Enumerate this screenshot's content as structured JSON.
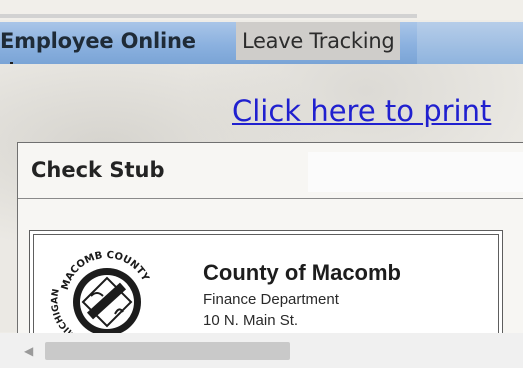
{
  "tabs": {
    "employee_online": "Employee Online",
    "leave_tracking": "Leave Tracking"
  },
  "print_link": "Click here to print",
  "check_stub": {
    "title": "Check Stub",
    "org_name": "County of Macomb",
    "department": "Finance Department",
    "address": "10 N. Main St.",
    "seal": {
      "top_text": "MACOMB COUNTY",
      "left_text": "MICHIGAN"
    }
  },
  "scrollbar": {
    "left_arrow_icon": "chevron-left-icon"
  },
  "colors": {
    "tabbar": "#8bb1df",
    "link": "#2020cf",
    "active_tab": "#cfcdca"
  }
}
